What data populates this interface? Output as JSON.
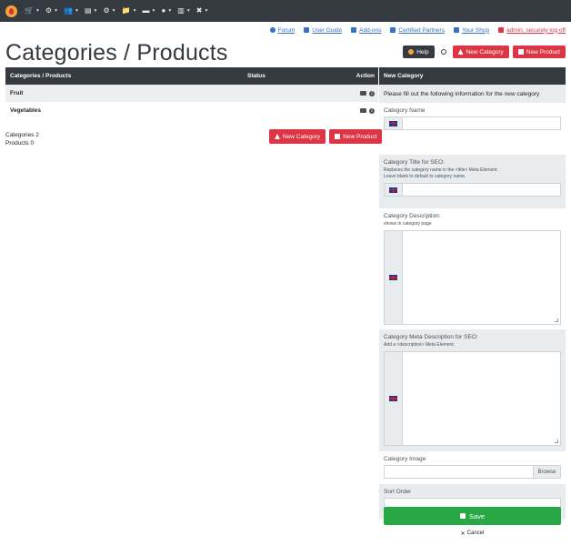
{
  "nav": {
    "items": [
      {
        "name": "cart",
        "glyph": "🛒"
      },
      {
        "name": "modules",
        "glyph": "⚙"
      },
      {
        "name": "customers",
        "glyph": "👥"
      },
      {
        "name": "orders",
        "glyph": "▤"
      },
      {
        "name": "tools",
        "glyph": "⚙"
      },
      {
        "name": "files",
        "glyph": "📁"
      },
      {
        "name": "payment",
        "glyph": "▬"
      },
      {
        "name": "time",
        "glyph": "●"
      },
      {
        "name": "stats",
        "glyph": "▥"
      },
      {
        "name": "extensions",
        "glyph": "✖"
      }
    ]
  },
  "toplinks": {
    "forum": "Forum",
    "guide": "User Guide",
    "addons": "Add-ons",
    "partners": "Certified Partners",
    "shop": "Your Shop",
    "logoff": "admin, securely log off"
  },
  "page": {
    "title": "Categories / Products"
  },
  "header_buttons": {
    "help": "Help",
    "new_category": "New Category",
    "new_product": "New Product"
  },
  "table": {
    "headers": {
      "name": "Categories / Products",
      "status": "Status",
      "action": "Action"
    },
    "rows": [
      {
        "name": "Fruit"
      },
      {
        "name": "Vegetables"
      }
    ],
    "counts": {
      "categories": "Categories 2",
      "products": "Products 0"
    },
    "buttons": {
      "new_category": "New Category",
      "new_product": "New Product"
    }
  },
  "panel": {
    "title": "New Category",
    "note": "Please fill out the following information for the new category",
    "category_name": {
      "label": "Category Name"
    },
    "seo_title": {
      "label": "Category Title for SEO:",
      "help1": "Replaces the category name in the <title> Meta Element.",
      "help2": "Leave blank to default to category name."
    },
    "description": {
      "label": "Category Description:",
      "help": "shows in category page"
    },
    "meta_desc": {
      "label": "Category Meta Description for SEO:",
      "help": "Add a <description> Meta Element."
    },
    "image": {
      "label": "Category Image",
      "browse": "Browse"
    },
    "sort_order": {
      "label": "Sort Order"
    },
    "save": "Save",
    "cancel": "Cancel"
  },
  "colors": {
    "dark": "#343a40",
    "red": "#dc3545",
    "green": "#28a745",
    "link": "#3571c8",
    "panel_grey": "#e9ecef"
  }
}
